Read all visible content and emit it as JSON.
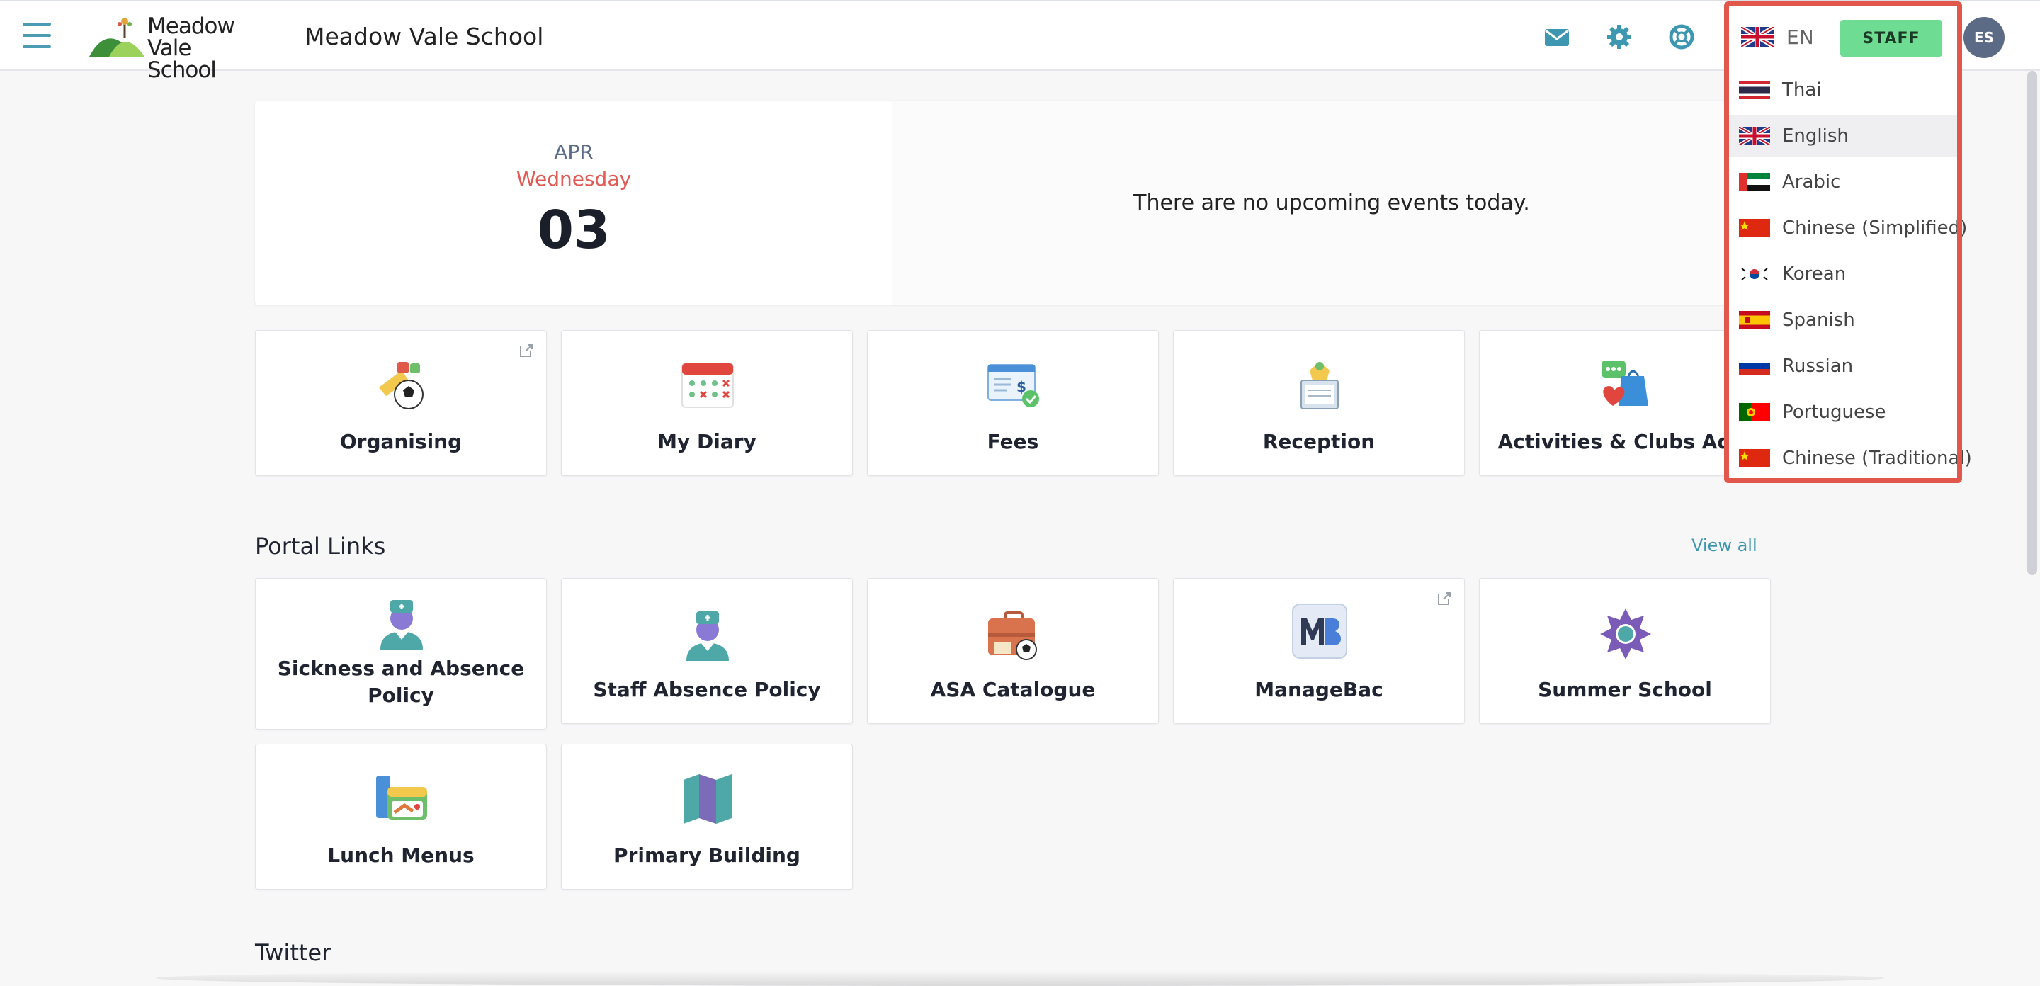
{
  "header": {
    "logo_line1": "Meadow",
    "logo_line2": "Vale School",
    "title": "Meadow Vale School",
    "icons": [
      "mail-icon",
      "gear-icon",
      "lifebuoy-icon"
    ],
    "language_code": "EN",
    "role_label": "STAFF",
    "avatar_initials": "ES"
  },
  "date_card": {
    "month": "APR",
    "weekday": "Wednesday",
    "day": "03",
    "no_events": "There are no upcoming events today."
  },
  "apps": [
    {
      "label": "Organising",
      "icon": "organising-icon"
    },
    {
      "label": "My Diary",
      "icon": "calendar-icon"
    },
    {
      "label": "Fees",
      "icon": "fees-icon"
    },
    {
      "label": "Reception",
      "icon": "reception-icon"
    },
    {
      "label": "Activities & Clubs Adm",
      "icon": "activities-icon"
    }
  ],
  "portal_links": {
    "title": "Portal Links",
    "view_all": "View all",
    "items": [
      {
        "label": "Sickness and Absence Policy",
        "icon": "nurse-icon"
      },
      {
        "label": "Staff Absence Policy",
        "icon": "nurse-icon"
      },
      {
        "label": "ASA Catalogue",
        "icon": "briefcase-icon"
      },
      {
        "label": "ManageBac",
        "icon": "managebac-icon"
      },
      {
        "label": "Summer School",
        "icon": "sun-icon"
      },
      {
        "label": "Lunch Menus",
        "icon": "lunchbox-icon"
      },
      {
        "label": "Primary Building",
        "icon": "map-icon"
      }
    ]
  },
  "twitter": {
    "title": "Twitter"
  },
  "language_menu": {
    "selected": "English",
    "items": [
      "Thai",
      "English",
      "Arabic",
      "Chinese (Simplified)",
      "Korean",
      "Spanish",
      "Russian",
      "Portuguese",
      "Chinese (Traditional)"
    ]
  },
  "colors": {
    "accent": "#4b9bb3",
    "staff": "#6fdc93",
    "highlight": "#e2574c",
    "weekday": "#e15a54"
  }
}
